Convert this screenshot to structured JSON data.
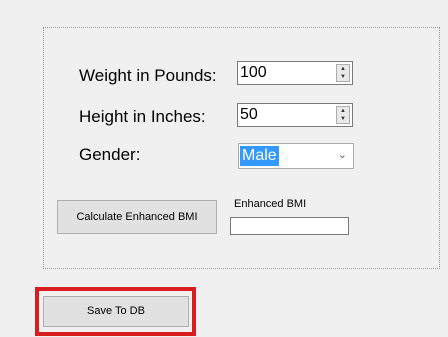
{
  "form": {
    "weight_label": "Weight in Pounds:",
    "weight_value": "100",
    "height_label": "Height in Inches:",
    "height_value": "50",
    "gender_label": "Gender:",
    "gender_selected": "Male",
    "calc_button": "Calculate Enhanced BMI",
    "bmi_label": "Enhanced BMI",
    "bmi_value": ""
  },
  "actions": {
    "save_button": "Save To DB"
  },
  "icons": {
    "spin_up": "spin-up-icon",
    "spin_down": "spin-down-icon",
    "dropdown": "chevron-down-icon"
  },
  "colors": {
    "highlight_border": "#d81e1e",
    "selection": "#3399ff"
  }
}
